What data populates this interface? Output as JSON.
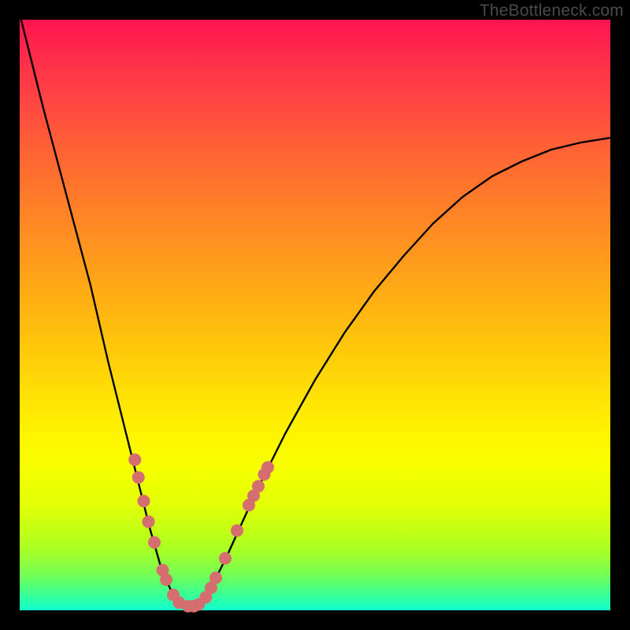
{
  "watermark": "TheBottleneck.com",
  "colors": {
    "frame": "#000000",
    "curve_stroke": "#000000",
    "marker_fill": "#d56e6e",
    "marker_stroke": "#b85a5a"
  },
  "chart_data": {
    "type": "line",
    "title": "",
    "xlabel": "",
    "ylabel": "",
    "xlim": [
      0,
      100
    ],
    "ylim": [
      0,
      100
    ],
    "grid": false,
    "note": "No axes, ticks, or legends are rendered in the image. Values are estimated from pixel positions; x runs left→right, y runs bottom→top (0 = bottom edge, 100 = top edge).",
    "series": [
      {
        "name": "curve",
        "x": [
          0,
          4,
          8,
          12,
          15,
          18,
          20,
          22,
          24,
          26,
          28,
          30,
          32,
          35,
          40,
          45,
          50,
          55,
          60,
          65,
          70,
          75,
          80,
          85,
          90,
          95,
          100
        ],
        "y": [
          101,
          85,
          70,
          55,
          42,
          30,
          22,
          14,
          7,
          2.5,
          0.7,
          0.7,
          3,
          9,
          20,
          30,
          39,
          47,
          54,
          60,
          65.5,
          70,
          73.5,
          76,
          78,
          79.2,
          80
        ]
      }
    ],
    "markers": [
      {
        "x": 19.5,
        "y": 25.5
      },
      {
        "x": 20.1,
        "y": 22.5
      },
      {
        "x": 21.0,
        "y": 18.5
      },
      {
        "x": 21.8,
        "y": 15.0
      },
      {
        "x": 22.8,
        "y": 11.5
      },
      {
        "x": 24.2,
        "y": 6.8
      },
      {
        "x": 24.8,
        "y": 5.2
      },
      {
        "x": 26.0,
        "y": 2.6
      },
      {
        "x": 27.0,
        "y": 1.3
      },
      {
        "x": 28.5,
        "y": 0.7
      },
      {
        "x": 29.5,
        "y": 0.7
      },
      {
        "x": 30.3,
        "y": 1.0
      },
      {
        "x": 31.5,
        "y": 2.2
      },
      {
        "x": 32.4,
        "y": 3.8
      },
      {
        "x": 33.2,
        "y": 5.5
      },
      {
        "x": 34.8,
        "y": 8.8
      },
      {
        "x": 36.8,
        "y": 13.5
      },
      {
        "x": 38.8,
        "y": 17.8
      },
      {
        "x": 39.6,
        "y": 19.4
      },
      {
        "x": 40.4,
        "y": 21.0
      },
      {
        "x": 41.4,
        "y": 23.0
      },
      {
        "x": 42.0,
        "y": 24.2
      }
    ]
  }
}
